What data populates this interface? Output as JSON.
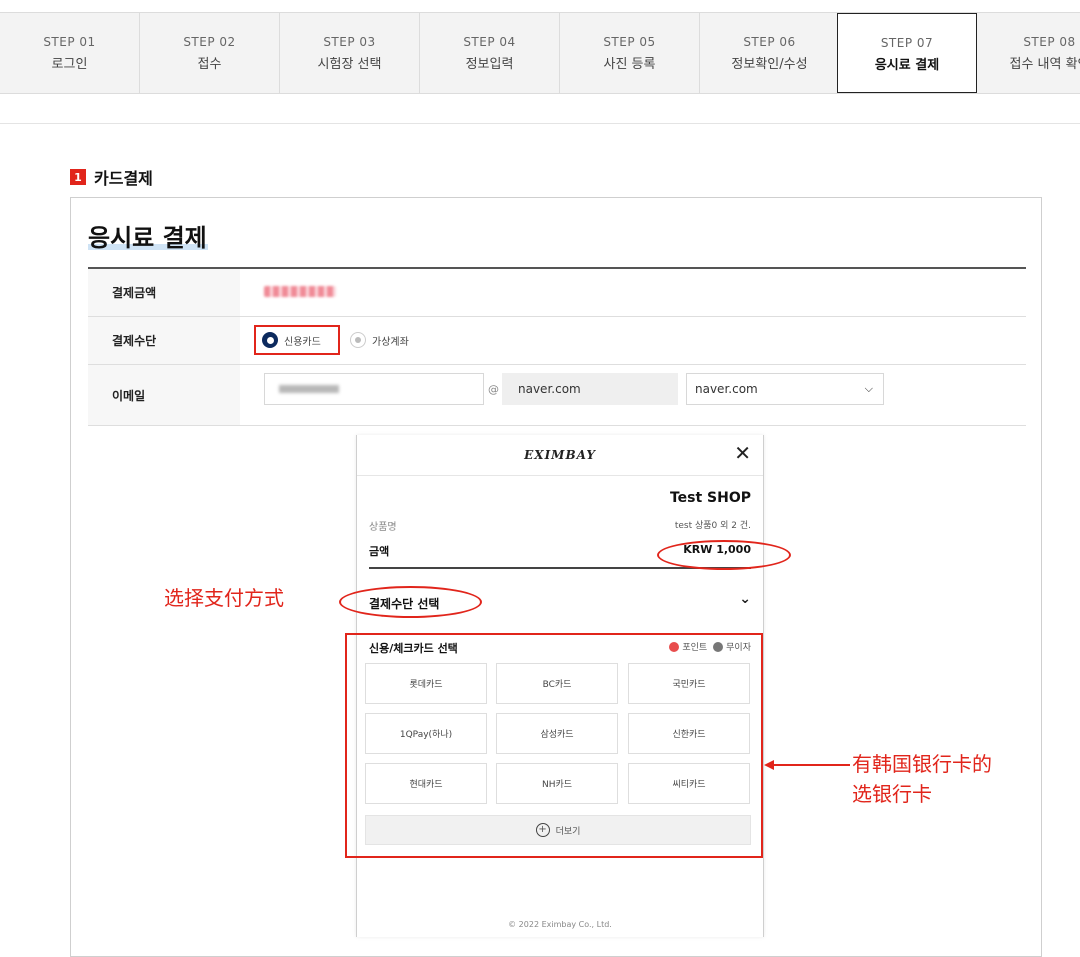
{
  "steps": [
    {
      "num": "STEP 01",
      "label": "로그인"
    },
    {
      "num": "STEP 02",
      "label": "접수"
    },
    {
      "num": "STEP 03",
      "label": "시험장 선택"
    },
    {
      "num": "STEP 04",
      "label": "정보입력"
    },
    {
      "num": "STEP 05",
      "label": "사진 등록"
    },
    {
      "num": "STEP 06",
      "label": "정보확인/수성"
    },
    {
      "num": "STEP 07",
      "label": "응시료 결제"
    },
    {
      "num": "STEP 08",
      "label": "접수 내역 확인"
    }
  ],
  "section": {
    "number": "1",
    "title": "카드결제"
  },
  "payment": {
    "title": "응시료 결제",
    "rows": {
      "amount_label": "결제금액",
      "method_label": "결제수단",
      "email_label": "이메일"
    },
    "method_options": [
      "신용카드",
      "가상계좌"
    ],
    "email": {
      "at": "@",
      "domain": "naver.com",
      "domain_select": "naver.com"
    }
  },
  "modal": {
    "logo": "EXIMBAY",
    "shop": "Test SHOP",
    "product_label": "상품명",
    "product_value": "test 상품0 외 2 건.",
    "amount_label": "금액",
    "amount_value": "KRW 1,000",
    "payment_method_label": "결제수단 선택",
    "card_section_title": "신용/체크카드 선택",
    "legend": [
      "포인트",
      "무이자"
    ],
    "cards": [
      "롯데카드",
      "BC카드",
      "국민카드",
      "1QPay(하나)",
      "삼성카드",
      "신한카드",
      "현대카드",
      "NH카드",
      "씨티카드"
    ],
    "more": "더보기",
    "copyright": "© 2022 Eximbay Co., Ltd."
  },
  "annotations": {
    "choose_method": "选择支付方式",
    "bank_card_line1": "有韩国银行卡的",
    "bank_card_line2": "选银行卡"
  },
  "colors": {
    "annotation": "#e1251b",
    "active_radio": "#0c2a5e"
  }
}
